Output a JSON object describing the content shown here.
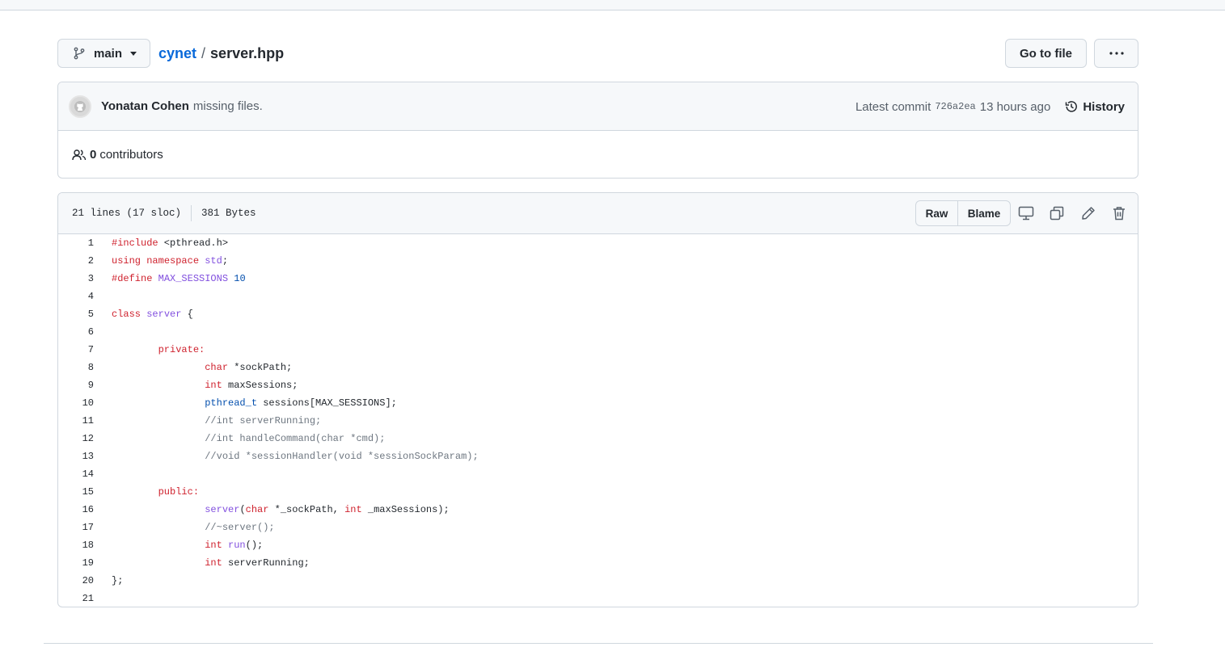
{
  "branch": {
    "name": "main",
    "icon": "git-branch-icon"
  },
  "breadcrumb": {
    "repo": "cynet",
    "separator": "/",
    "file": "server.hpp"
  },
  "actions": {
    "goto_file": "Go to file",
    "more": "···"
  },
  "commit": {
    "author": "Yonatan Cohen",
    "message": "missing files.",
    "latest_label": "Latest commit",
    "sha": "726a2ea",
    "time": "13 hours ago",
    "history_label": "History"
  },
  "contributors": {
    "count": "0",
    "label": "contributors"
  },
  "file": {
    "lines_info": "21 lines (17 sloc)",
    "size": "381 Bytes",
    "raw_label": "Raw",
    "blame_label": "Blame"
  },
  "code_lines": [
    [
      {
        "t": "kw",
        "v": "#include"
      },
      {
        "t": "",
        "v": " <pthread.h>"
      }
    ],
    [
      {
        "t": "kw",
        "v": "using"
      },
      {
        "t": "",
        "v": " "
      },
      {
        "t": "kw",
        "v": "namespace"
      },
      {
        "t": "",
        "v": " "
      },
      {
        "t": "fn",
        "v": "std"
      },
      {
        "t": "",
        "v": ";"
      }
    ],
    [
      {
        "t": "kw",
        "v": "#define"
      },
      {
        "t": "",
        "v": " "
      },
      {
        "t": "fn",
        "v": "MAX_SESSIONS"
      },
      {
        "t": "",
        "v": " "
      },
      {
        "t": "ty",
        "v": "10"
      }
    ],
    [],
    [
      {
        "t": "kw",
        "v": "class"
      },
      {
        "t": "",
        "v": " "
      },
      {
        "t": "fn",
        "v": "server"
      },
      {
        "t": "",
        "v": " {"
      }
    ],
    [],
    [
      {
        "t": "",
        "v": "        "
      },
      {
        "t": "kw",
        "v": "private:"
      }
    ],
    [
      {
        "t": "",
        "v": "                "
      },
      {
        "t": "kw",
        "v": "char"
      },
      {
        "t": "",
        "v": " *sockPath;"
      }
    ],
    [
      {
        "t": "",
        "v": "                "
      },
      {
        "t": "kw",
        "v": "int"
      },
      {
        "t": "",
        "v": " maxSessions;"
      }
    ],
    [
      {
        "t": "",
        "v": "                "
      },
      {
        "t": "ty",
        "v": "pthread_t"
      },
      {
        "t": "",
        "v": " sessions[MAX_SESSIONS];"
      }
    ],
    [
      {
        "t": "",
        "v": "                "
      },
      {
        "t": "cm",
        "v": "//int serverRunning;"
      }
    ],
    [
      {
        "t": "",
        "v": "                "
      },
      {
        "t": "cm",
        "v": "//int handleCommand(char *cmd);"
      }
    ],
    [
      {
        "t": "",
        "v": "                "
      },
      {
        "t": "cm",
        "v": "//void *sessionHandler(void *sessionSockParam);"
      }
    ],
    [],
    [
      {
        "t": "",
        "v": "        "
      },
      {
        "t": "kw",
        "v": "public:"
      }
    ],
    [
      {
        "t": "",
        "v": "                "
      },
      {
        "t": "fn",
        "v": "server"
      },
      {
        "t": "",
        "v": "("
      },
      {
        "t": "kw",
        "v": "char"
      },
      {
        "t": "",
        "v": " *_sockPath, "
      },
      {
        "t": "kw",
        "v": "int"
      },
      {
        "t": "",
        "v": " _maxSessions);"
      }
    ],
    [
      {
        "t": "",
        "v": "                "
      },
      {
        "t": "cm",
        "v": "//~server();"
      }
    ],
    [
      {
        "t": "",
        "v": "                "
      },
      {
        "t": "kw",
        "v": "int"
      },
      {
        "t": "",
        "v": " "
      },
      {
        "t": "fn",
        "v": "run"
      },
      {
        "t": "",
        "v": "();"
      }
    ],
    [
      {
        "t": "",
        "v": "                "
      },
      {
        "t": "kw",
        "v": "int"
      },
      {
        "t": "",
        "v": " serverRunning;"
      }
    ],
    [
      {
        "t": "",
        "v": "};"
      }
    ],
    []
  ],
  "colors": {
    "link": "#0969da",
    "keyword": "#cf222e",
    "function": "#8250df",
    "type": "#0550ae",
    "comment": "#6e7781",
    "border": "#d0d7de",
    "header_bg": "#f6f8fa"
  }
}
